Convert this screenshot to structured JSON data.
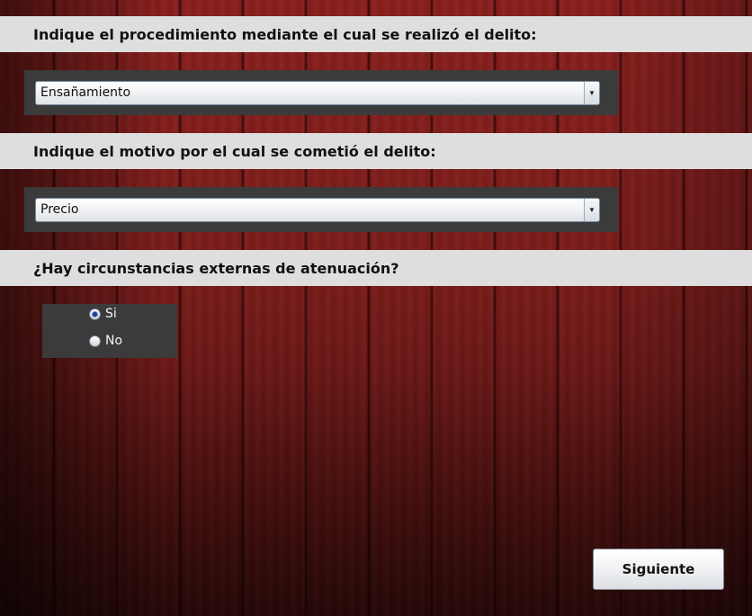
{
  "questions": [
    {
      "text": "Indique el procedimiento mediante el cual se realizó el delito:"
    },
    {
      "text": "Indique el motivo por el cual se cometió el delito:"
    },
    {
      "text": "¿Hay circunstancias externas de atenuación?"
    }
  ],
  "procedure_select": {
    "value": "Ensañamiento"
  },
  "motive_select": {
    "value": "Precio"
  },
  "mitigation_radio": {
    "options": [
      {
        "label": "Si",
        "checked": true
      },
      {
        "label": "No",
        "checked": false
      }
    ]
  },
  "next_button": {
    "label": "Siguiente"
  },
  "icons": {
    "dropdown_arrow": "▼"
  }
}
